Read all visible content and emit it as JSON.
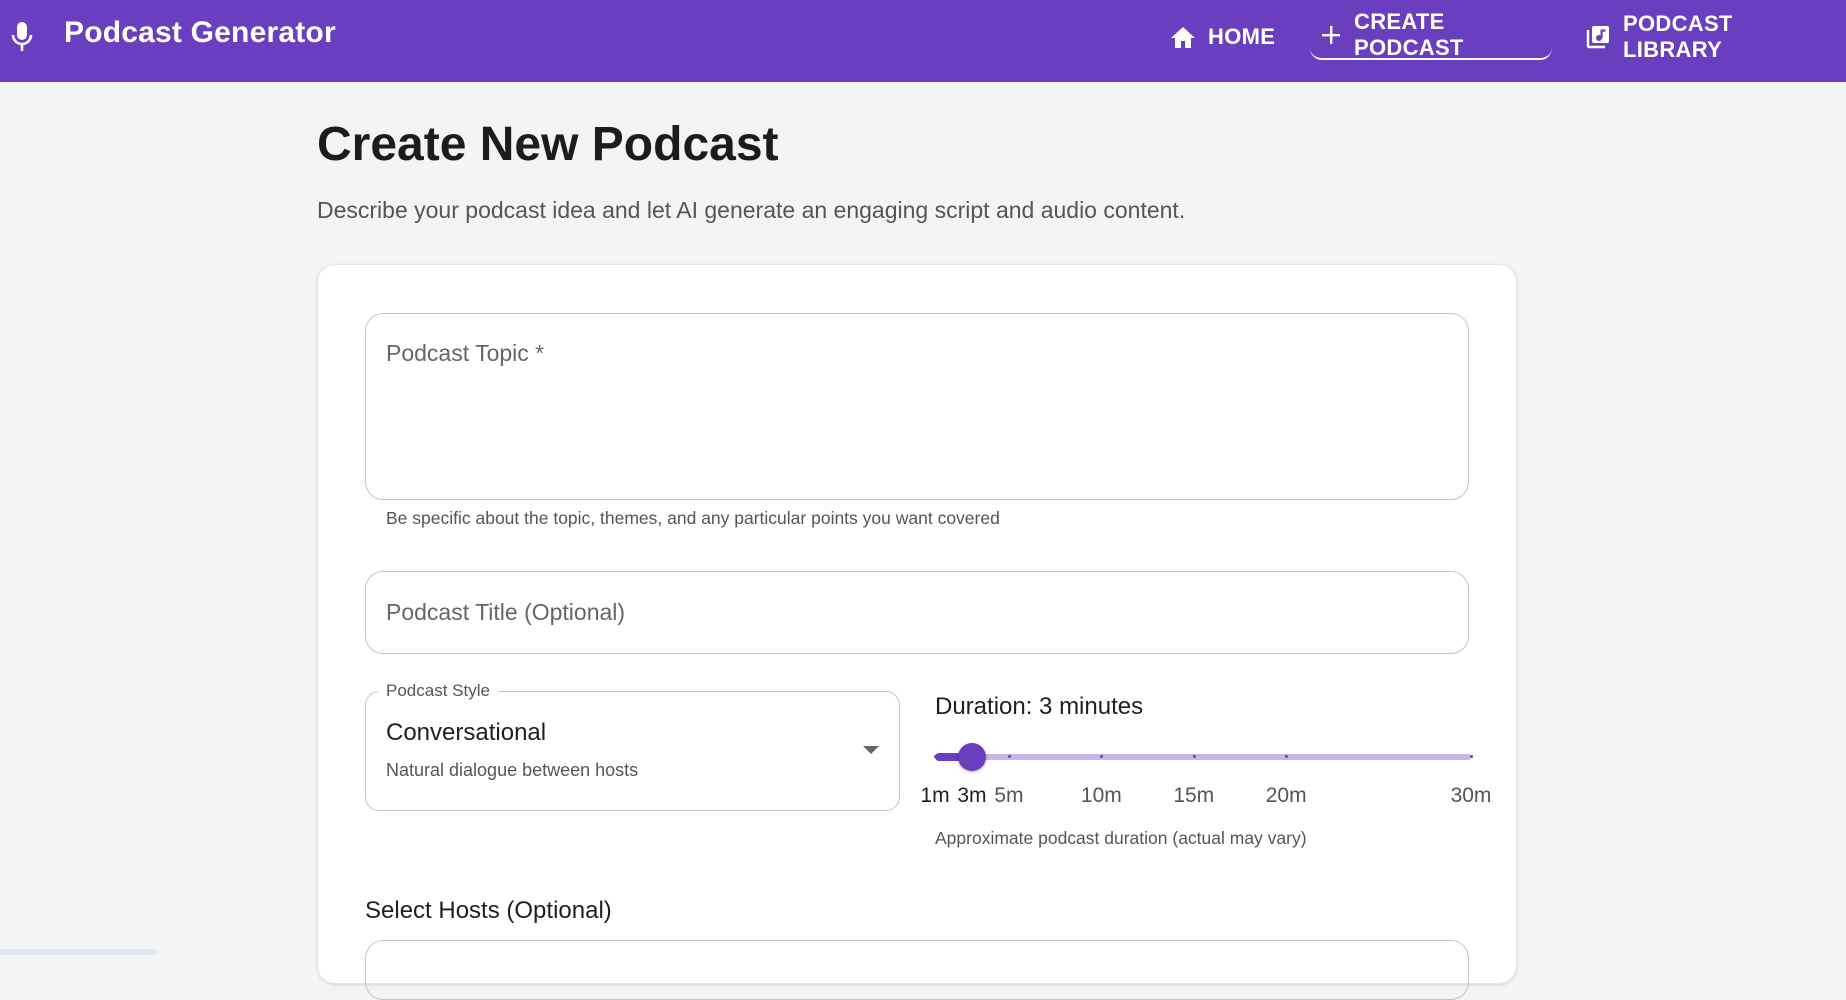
{
  "app": {
    "title": "Podcast Generator",
    "brand_color": "#6a3fbf",
    "icon": "microphone-icon"
  },
  "nav": {
    "home": "HOME",
    "create": "CREATE PODCAST",
    "library": "PODCAST LIBRARY",
    "active": "create"
  },
  "page": {
    "title": "Create New Podcast",
    "subtitle": "Describe your podcast idea and let AI generate an engaging script and audio content."
  },
  "form": {
    "topic": {
      "placeholder": "Podcast Topic *",
      "value": "",
      "helper": "Be specific about the topic, themes, and any particular points you want covered"
    },
    "title": {
      "placeholder": "Podcast Title (Optional)",
      "value": ""
    },
    "style": {
      "label": "Podcast Style",
      "value": "Conversational",
      "description": "Natural dialogue between hosts"
    },
    "duration": {
      "label": "Duration: 3 minutes",
      "value": 3,
      "min": 1,
      "max": 30,
      "marks": [
        1,
        3,
        5,
        10,
        15,
        20,
        30
      ],
      "mark_labels": [
        "1m",
        "3m",
        "5m",
        "10m",
        "15m",
        "20m",
        "30m"
      ],
      "helper": "Approximate podcast duration (actual may vary)"
    },
    "hosts": {
      "label": "Select Hosts (Optional)"
    }
  }
}
